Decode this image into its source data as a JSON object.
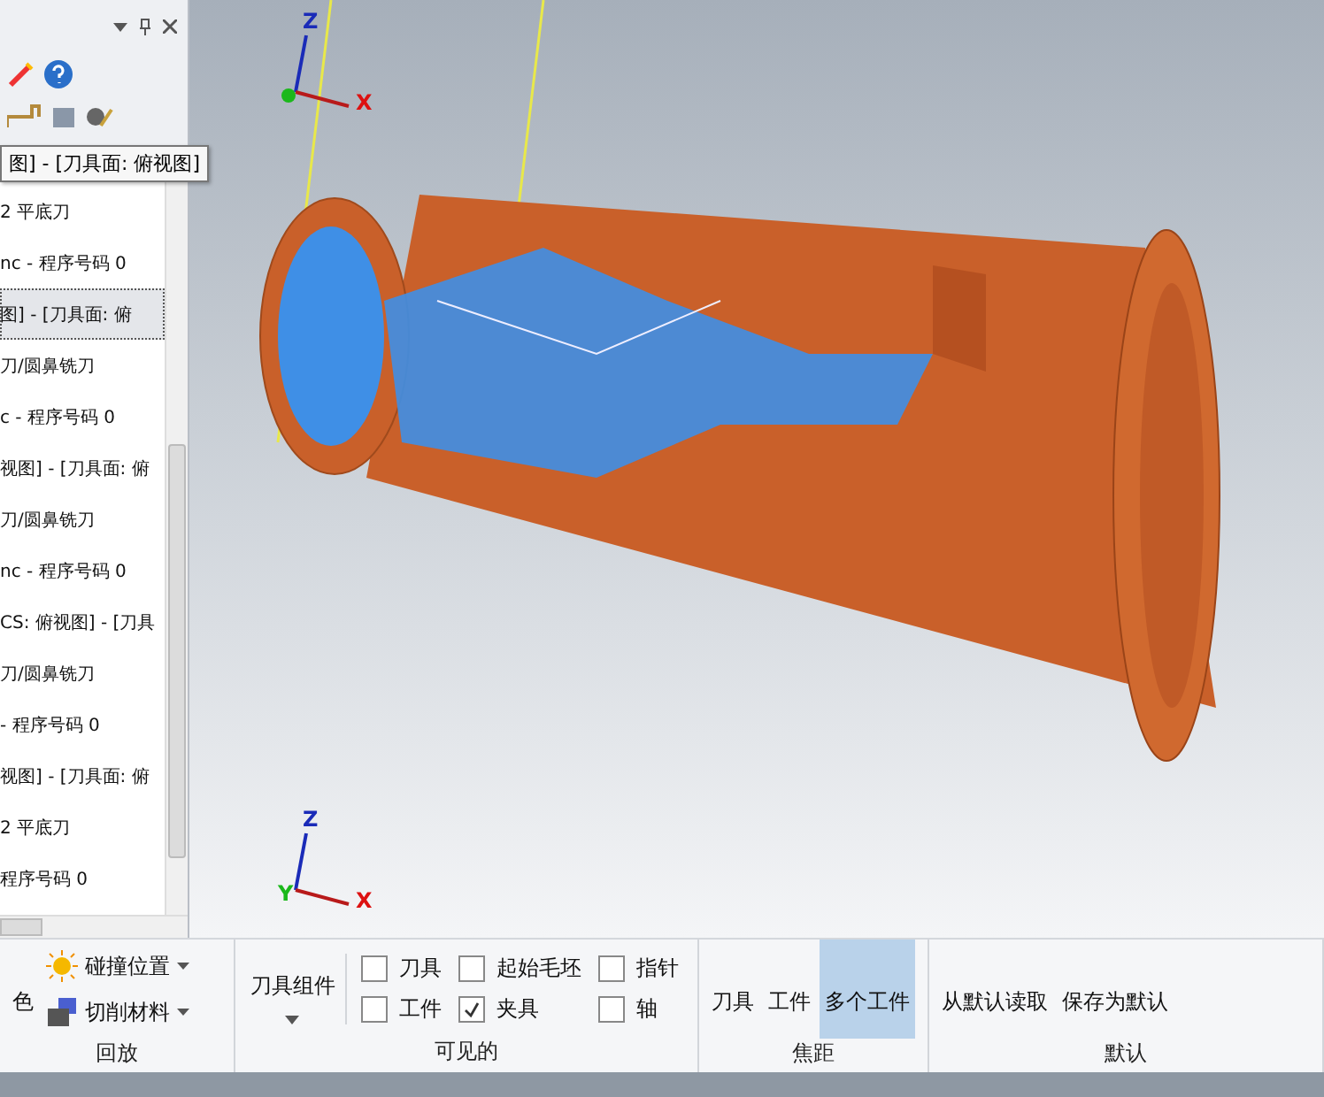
{
  "panel": {
    "tooltip": "图] - [刀具面: 俯视图]",
    "rows": [
      {
        "text": "2 平底刀",
        "selected": false
      },
      {
        "text": "nc - 程序号码 0",
        "selected": false
      },
      {
        "text": "图] - [刀具面: 俯",
        "selected": true
      },
      {
        "text": "刀/圆鼻铣刀",
        "selected": false
      },
      {
        "text": "c - 程序号码 0",
        "selected": false
      },
      {
        "text": "视图] - [刀具面: 俯",
        "selected": false
      },
      {
        "text": "刀/圆鼻铣刀",
        "selected": false
      },
      {
        "text": "nc - 程序号码 0",
        "selected": false
      },
      {
        "text": "CS: 俯视图] - [刀具",
        "selected": false
      },
      {
        "text": "刀/圆鼻铣刀",
        "selected": false
      },
      {
        "text": "- 程序号码 0",
        "selected": false
      },
      {
        "text": "视图] - [刀具面: 俯",
        "selected": false
      },
      {
        "text": "2 平底刀",
        "selected": false
      },
      {
        "text": "程序号码 0",
        "selected": false
      }
    ]
  },
  "viewport": {
    "triads": [
      {
        "labels": [
          "Z",
          "X"
        ]
      },
      {
        "labels": [
          "Z",
          "Y",
          "X"
        ]
      }
    ]
  },
  "ribbon": {
    "groups": [
      {
        "label": "回放",
        "items": [
          {
            "kind": "large",
            "text": "色"
          },
          {
            "kind": "menu",
            "text": "碰撞位置"
          },
          {
            "kind": "menu",
            "text": "切削材料"
          }
        ]
      },
      {
        "label": "可见的",
        "items": [
          {
            "kind": "dropdown",
            "text": "刀具组件"
          },
          {
            "kind": "check",
            "text": "刀具",
            "checked": false
          },
          {
            "kind": "check",
            "text": "起始毛坯",
            "checked": false
          },
          {
            "kind": "check",
            "text": "指针",
            "checked": false
          },
          {
            "kind": "check",
            "text": "工件",
            "checked": false
          },
          {
            "kind": "check",
            "text": "夹具",
            "checked": true
          },
          {
            "kind": "check",
            "text": "轴",
            "checked": false
          }
        ]
      },
      {
        "label": "焦距",
        "items": [
          {
            "kind": "large",
            "text": "刀具",
            "selected": false
          },
          {
            "kind": "large",
            "text": "工件",
            "selected": false
          },
          {
            "kind": "large",
            "text": "多个工件",
            "selected": true
          }
        ]
      },
      {
        "label": "默认",
        "items": [
          {
            "kind": "large",
            "text": "从默认读取"
          },
          {
            "kind": "large",
            "text": "保存为默认"
          }
        ]
      }
    ]
  }
}
